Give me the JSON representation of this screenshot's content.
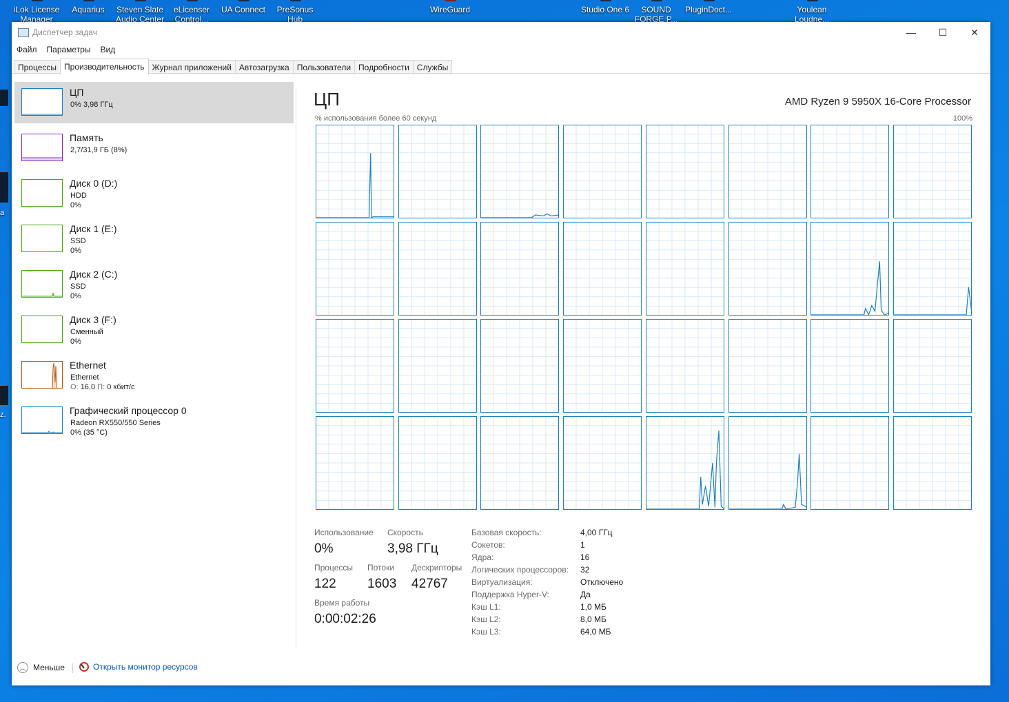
{
  "desktop": {
    "icons": [
      {
        "line1": "iLok License",
        "line2": "Manager"
      },
      {
        "line1": "Aquarius",
        "line2": ""
      },
      {
        "line1": "Steven Slate",
        "line2": "Audio Center"
      },
      {
        "line1": "eLicenser",
        "line2": "Control..."
      },
      {
        "line1": "UA Connect",
        "line2": ""
      },
      {
        "line1": "PreSonus",
        "line2": "Hub"
      },
      {
        "line1": "WireGuard",
        "line2": ""
      },
      {
        "line1": "Studio One 6",
        "line2": ""
      },
      {
        "line1": "SOUND",
        "line2": "FORGE P..."
      },
      {
        "line1": "PluginDoct...",
        "line2": ""
      },
      {
        "line1": "Youlean",
        "line2": "Loudne..."
      }
    ],
    "edge_texts": [
      "a",
      "z."
    ]
  },
  "window": {
    "title": "Диспетчер задач",
    "controls": {
      "minimize": "—",
      "maximize": "☐",
      "close": "✕"
    }
  },
  "menu": [
    "Файл",
    "Параметры",
    "Вид"
  ],
  "tabs": [
    {
      "label": "Процессы",
      "active": false
    },
    {
      "label": "Производительность",
      "active": true
    },
    {
      "label": "Журнал приложений",
      "active": false
    },
    {
      "label": "Автозагрузка",
      "active": false
    },
    {
      "label": "Пользователи",
      "active": false
    },
    {
      "label": "Подробности",
      "active": false
    },
    {
      "label": "Службы",
      "active": false
    }
  ],
  "resources": [
    {
      "title": "ЦП",
      "sub1": "0% 3,98 ГГц",
      "sub2": "",
      "color": "#1d7fbf",
      "selected": true
    },
    {
      "title": "Память",
      "sub1": "2,7/31,9 ГБ (8%)",
      "sub2": "",
      "color": "#8b2bb5",
      "selected": false
    },
    {
      "title": "Диск 0 (D:)",
      "sub1": "HDD",
      "sub2": "0%",
      "color": "#4da60c",
      "selected": false
    },
    {
      "title": "Диск 1 (E:)",
      "sub1": "SSD",
      "sub2": "0%",
      "color": "#4da60c",
      "selected": false
    },
    {
      "title": "Диск 2 (C:)",
      "sub1": "SSD",
      "sub2": "0%",
      "color": "#4da60c",
      "selected": false
    },
    {
      "title": "Диск 3 (F:)",
      "sub1": "Сменный",
      "sub2": "0%",
      "color": "#4da60c",
      "selected": false
    },
    {
      "title": "Ethernet",
      "sub1": "Ethernet",
      "sub2_prefix": "О:",
      "sub2_value": "16,0",
      "sub2_prefix2": "П:",
      "sub2_value2": "0 кбит/с",
      "color": "#b7570d",
      "selected": false
    },
    {
      "title": "Графический процессор 0",
      "sub1": "Radeon RX550/550 Series",
      "sub2": "0% (35 °C)",
      "color": "#1d7fbf",
      "selected": false
    }
  ],
  "cpu": {
    "title": "ЦП",
    "model": "AMD Ryzen 9 5950X 16-Core Processor",
    "graph_caption": "% использования более 60 секунд",
    "graph_max": "100%",
    "line_color": "#1d7fbf",
    "grid_color": "#d9eaf5",
    "border_color": "#1d7fbf"
  },
  "stats": {
    "usage_label": "Использование",
    "usage_value": "0%",
    "speed_label": "Скорость",
    "speed_value": "3,98 ГГц",
    "processes_label": "Процессы",
    "processes_value": "122",
    "threads_label": "Потоки",
    "threads_value": "1603",
    "handles_label": "Дескрипторы",
    "handles_value": "42767",
    "uptime_label": "Время работы",
    "uptime_value": "0:00:02:26"
  },
  "details": [
    {
      "key": "Базовая скорость:",
      "value": "4,00 ГГц"
    },
    {
      "key": "Сокетов:",
      "value": "1"
    },
    {
      "key": "Ядра:",
      "value": "16"
    },
    {
      "key": "Логических процессоров:",
      "value": "32"
    },
    {
      "key": "Виртуализация:",
      "value": "Отключено"
    },
    {
      "key": "Поддержка Hyper-V:",
      "value": "Да"
    },
    {
      "key": "Кэш L1:",
      "value": "1,0 МБ"
    },
    {
      "key": "Кэш L2:",
      "value": "8,0 МБ"
    },
    {
      "key": "Кэш L3:",
      "value": "64,0 МБ"
    }
  ],
  "footer": {
    "less_label": "Меньше",
    "monitor_label": "Открыть монитор ресурсов"
  }
}
